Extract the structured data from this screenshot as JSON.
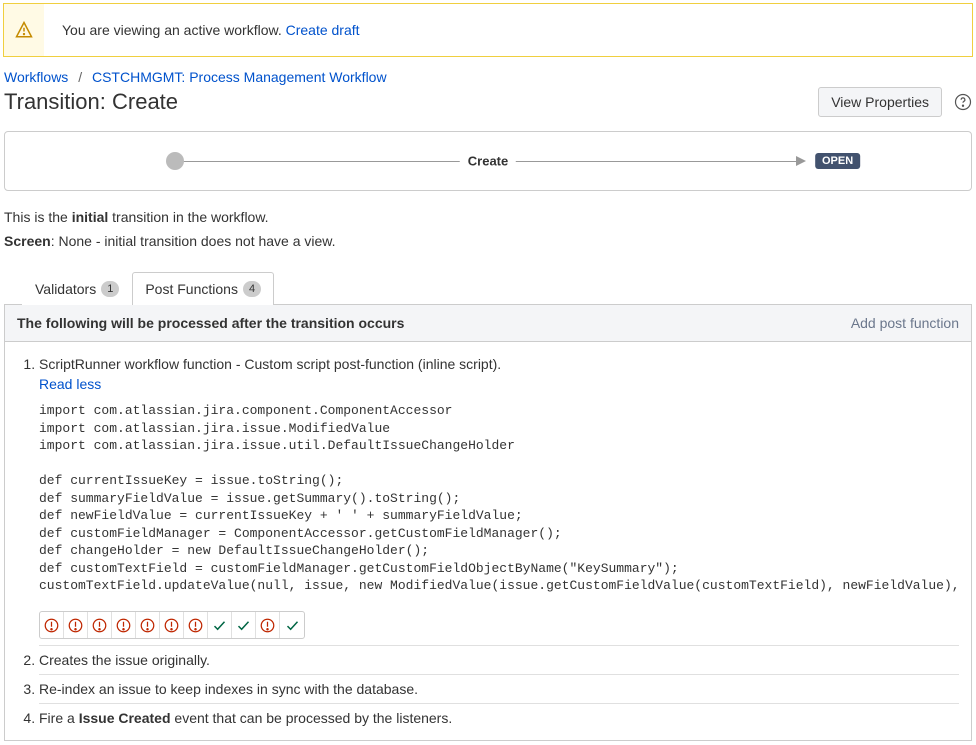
{
  "notice": {
    "text": "You are viewing an active workflow. ",
    "link": "Create draft"
  },
  "breadcrumbs": {
    "a": "Workflows",
    "b": "CSTCHMGMT: Process Management Workflow"
  },
  "title": "Transition: Create",
  "view_properties": "View Properties",
  "diagram": {
    "create": "Create",
    "open": "OPEN"
  },
  "desc_parts": {
    "a": "This is the ",
    "b": "initial",
    "c": " transition in the workflow."
  },
  "screen": {
    "label": "Screen",
    "text": ": None - initial transition does not have a view."
  },
  "tabs": {
    "validators": {
      "label": "Validators",
      "count": "1"
    },
    "postfns": {
      "label": "Post Functions",
      "count": "4"
    }
  },
  "panel": {
    "header": "The following will be processed after the transition occurs",
    "add": "Add post function"
  },
  "item1": {
    "line": "ScriptRunner workflow function - Custom script post-function (inline script).",
    "read_less": "Read less",
    "code": "import com.atlassian.jira.component.ComponentAccessor\nimport com.atlassian.jira.issue.ModifiedValue\nimport com.atlassian.jira.issue.util.DefaultIssueChangeHolder\n\ndef currentIssueKey = issue.toString();\ndef summaryFieldValue = issue.getSummary().toString();\ndef newFieldValue = currentIssueKey + ' ' + summaryFieldValue;\ndef customFieldManager = ComponentAccessor.getCustomFieldManager();\ndef changeHolder = new DefaultIssueChangeHolder();\ndef customTextField = customFieldManager.getCustomFieldObjectByName(\"KeySummary\");\ncustomTextField.updateValue(null, issue, new ModifiedValue(issue.getCustomFieldValue(customTextField), newFieldValue), changeHolder);",
    "status": [
      "err",
      "err",
      "err",
      "err",
      "err",
      "err",
      "err",
      "ok",
      "ok",
      "err",
      "ok"
    ]
  },
  "item2": "Creates the issue originally.",
  "item3": "Re-index an issue to keep indexes in sync with the database.",
  "item4": {
    "a": "Fire a ",
    "b": "Issue Created",
    "c": " event that can be processed by the listeners."
  }
}
